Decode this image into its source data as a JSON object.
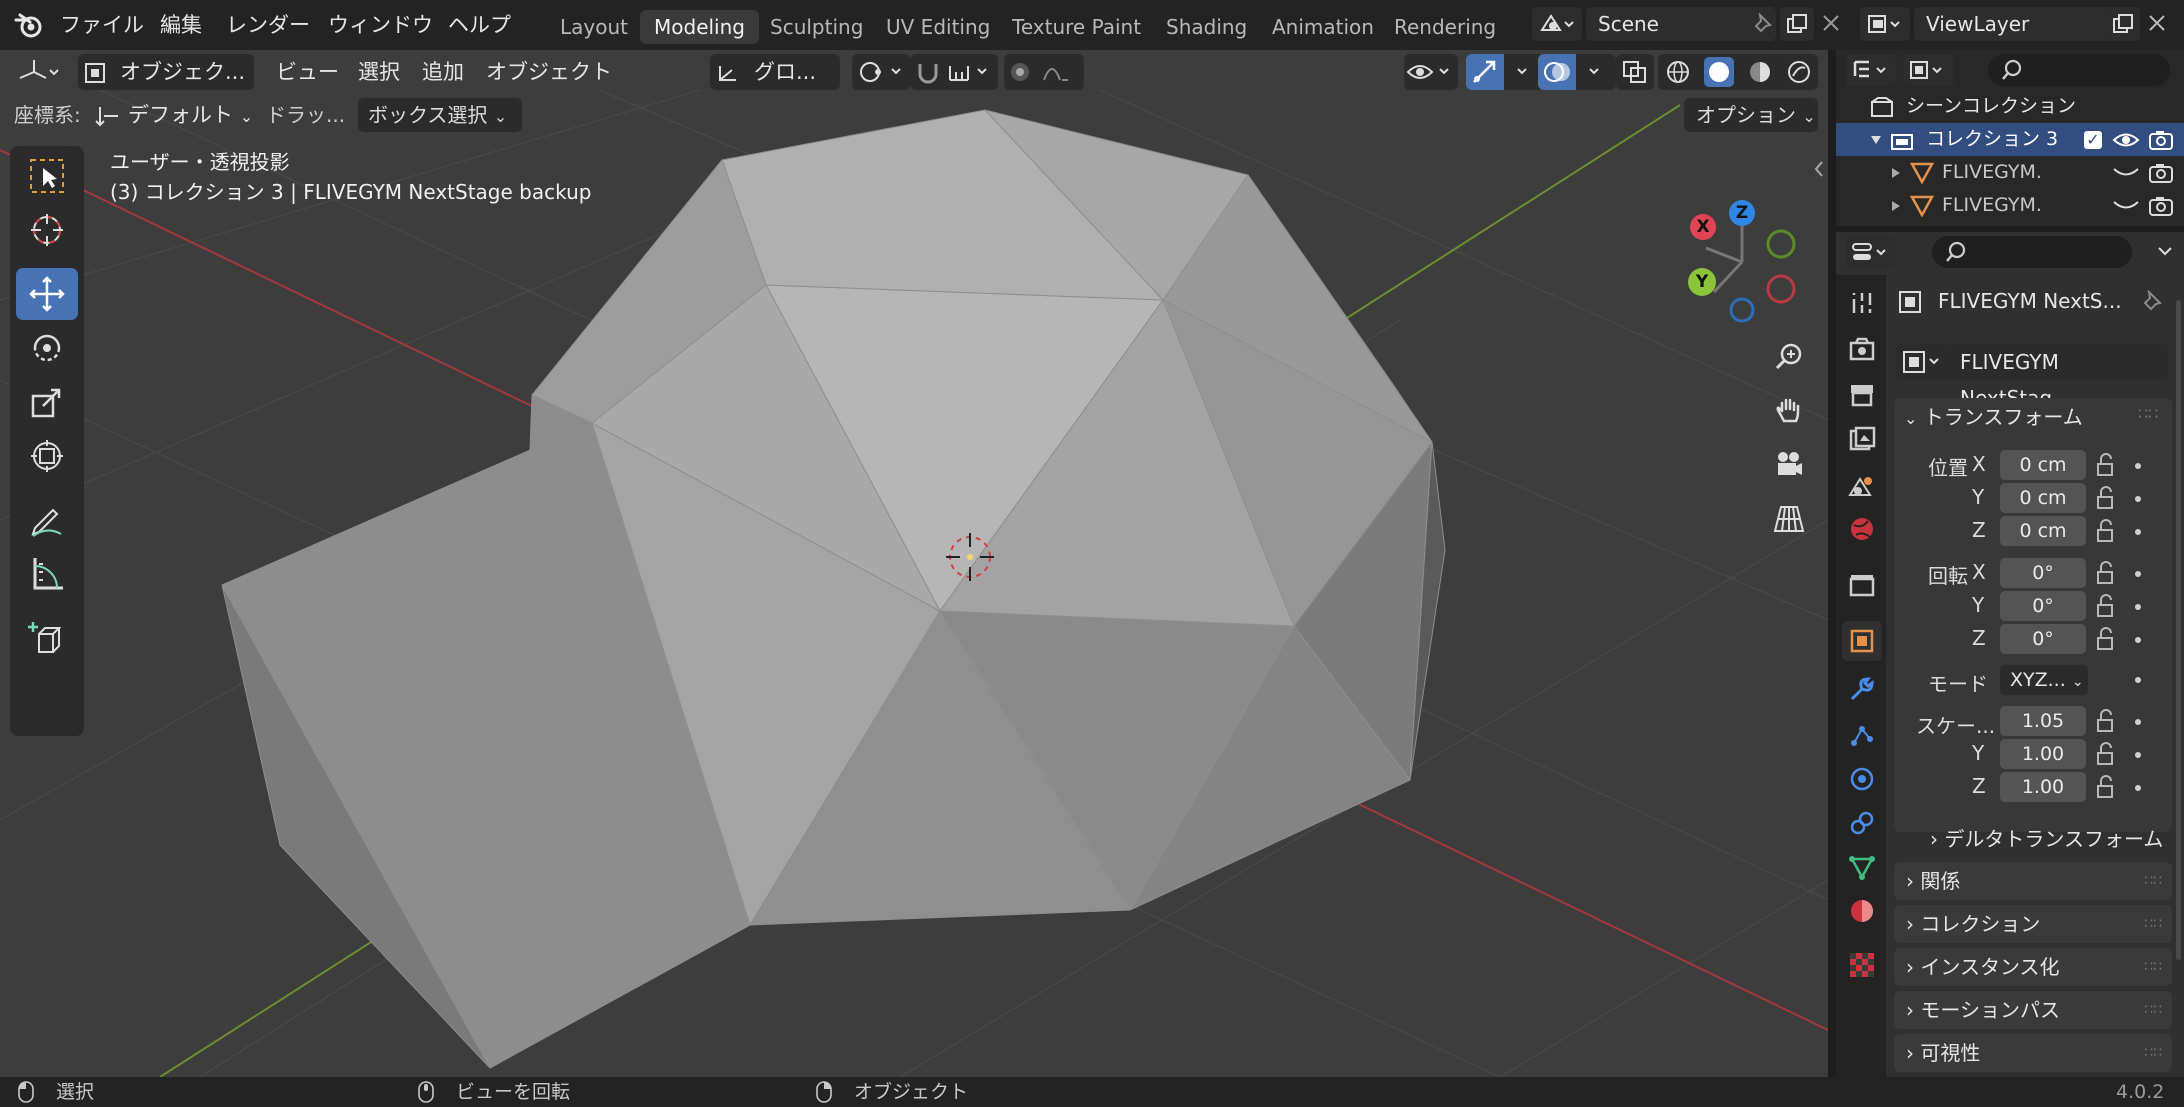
{
  "topbar": {
    "menus": [
      "ファイル",
      "編集",
      "レンダー",
      "ウィンドウ",
      "ヘルプ"
    ],
    "workspaces": [
      "Layout",
      "Modeling",
      "Sculpting",
      "UV Editing",
      "Texture Paint",
      "Shading",
      "Animation",
      "Rendering"
    ],
    "active_workspace": "Modeling",
    "scene": "Scene",
    "view_layer": "ViewLayer"
  },
  "viewport": {
    "header": {
      "mode": "オブジェク...",
      "menus": [
        "ビュー",
        "選択",
        "追加",
        "オブジェクト"
      ],
      "transform_orientation": "グロ..."
    },
    "toolsettings": {
      "coord_label": "座標系:",
      "coord_value": "デフォルト",
      "drag_label": "ドラッ...",
      "drag_value": "ボックス選択",
      "options": "オプション"
    },
    "overlay_text": {
      "view_name": "ユーザー・透視投影",
      "object_info": "(3) コレクション 3 | FLIVEGYM NextStage backup"
    },
    "gizmo": {
      "x": "X",
      "y": "Y",
      "z": "Z"
    }
  },
  "outliner": {
    "scene_collection": "シーンコレクション",
    "collection": "コレクション 3",
    "items": [
      "FLIVEGYM.",
      "FLIVEGYM."
    ]
  },
  "properties": {
    "object_name": "FLIVEGYM NextS...",
    "data_name": "FLIVEGYM NextStag...",
    "transform_title": "トランスフォーム",
    "location": {
      "label": "位置",
      "x": "0 cm",
      "y": "0 cm",
      "z": "0 cm"
    },
    "rotation": {
      "label": "回転",
      "x": "0°",
      "y": "0°",
      "z": "0°"
    },
    "mode": {
      "label": "モード",
      "value": "XYZ..."
    },
    "scale": {
      "label": "スケー...",
      "x": "1.05",
      "y": "1.00",
      "z": "1.00"
    },
    "axes": {
      "x": "X",
      "y": "Y",
      "z": "Z"
    },
    "delta_transform": "デルタトランスフォーム",
    "panels": [
      "関係",
      "コレクション",
      "インスタンス化",
      "モーションパス",
      "可視性"
    ]
  },
  "statusbar": {
    "select": "選択",
    "rotate_view": "ビューを回転",
    "object": "オブジェクト",
    "version": "4.0.2"
  },
  "colors": {
    "accent": "#4772b3",
    "axis_x": "#e04553",
    "axis_y": "#8bc43b",
    "axis_z": "#2f86e5",
    "mesh": "#9a9a9a",
    "viewport_bg": "#3d3d3d"
  }
}
